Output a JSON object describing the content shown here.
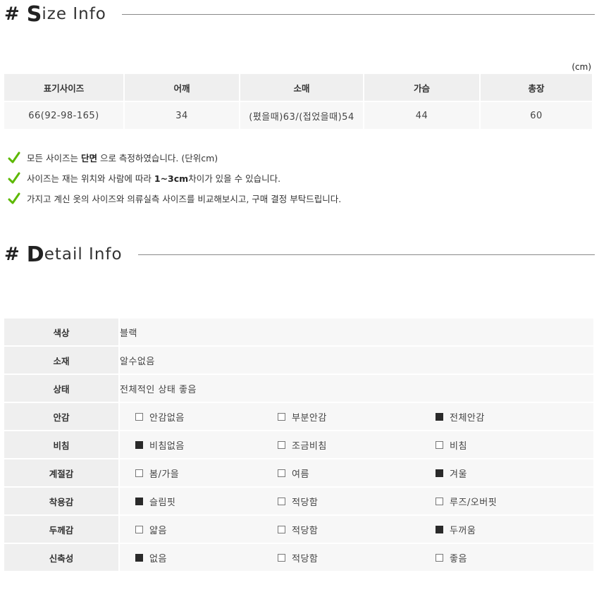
{
  "size_section": {
    "hash": "#",
    "title_first": "S",
    "title_rest": "ize Info",
    "unit": "(cm)",
    "headers": [
      "표기사이즈",
      "어깨",
      "소매",
      "가슴",
      "총장"
    ],
    "row": [
      "66(92-98-165)",
      "34",
      "(폈을때)63/(접었을때)54",
      "44",
      "60"
    ]
  },
  "notes": [
    {
      "pre": "모든 사이즈는 ",
      "bold": "단면",
      "post": " 으로 측정하였습니다. (단위cm)"
    },
    {
      "pre": "사이즈는 재는 위치와 사람에 따라 ",
      "bold": "1~3cm",
      "post": "차이가 있을 수 있습니다."
    },
    {
      "pre": "가지고 계신 옷의 사이즈와 의류실측 사이즈를 비교해보시고, 구매 결정 부탁드립니다.",
      "bold": "",
      "post": ""
    }
  ],
  "detail_section": {
    "hash": "#",
    "title_first": "D",
    "title_rest": "etail Info",
    "rows_plain": [
      {
        "label": "색상",
        "value": "블랙"
      },
      {
        "label": "소재",
        "value": "알수없음"
      },
      {
        "label": "상태",
        "value": "전체적인 상태 좋음"
      }
    ],
    "rows_options": [
      {
        "label": "안감",
        "options": [
          {
            "text": "안감없음",
            "checked": false
          },
          {
            "text": "부분안감",
            "checked": false
          },
          {
            "text": "전체안감",
            "checked": true
          }
        ]
      },
      {
        "label": "비침",
        "options": [
          {
            "text": "비침없음",
            "checked": true
          },
          {
            "text": "조금비침",
            "checked": false
          },
          {
            "text": "비침",
            "checked": false
          }
        ]
      },
      {
        "label": "계절감",
        "options": [
          {
            "text": "봄/가을",
            "checked": false
          },
          {
            "text": "여름",
            "checked": false
          },
          {
            "text": "겨울",
            "checked": true
          }
        ]
      },
      {
        "label": "착용감",
        "options": [
          {
            "text": "슬림핏",
            "checked": true
          },
          {
            "text": "적당함",
            "checked": false
          },
          {
            "text": "루즈/오버핏",
            "checked": false
          }
        ]
      },
      {
        "label": "두께감",
        "options": [
          {
            "text": "얇음",
            "checked": false
          },
          {
            "text": "적당함",
            "checked": false
          },
          {
            "text": "두꺼움",
            "checked": true
          }
        ]
      },
      {
        "label": "신축성",
        "options": [
          {
            "text": "없음",
            "checked": true
          },
          {
            "text": "적당함",
            "checked": false
          },
          {
            "text": "좋음",
            "checked": false
          }
        ]
      }
    ]
  },
  "colors": {
    "check": "#5cb800",
    "checked_box": "#2a2a2a",
    "header_bg": "#efefef",
    "cell_bg": "#f7f7f7"
  }
}
